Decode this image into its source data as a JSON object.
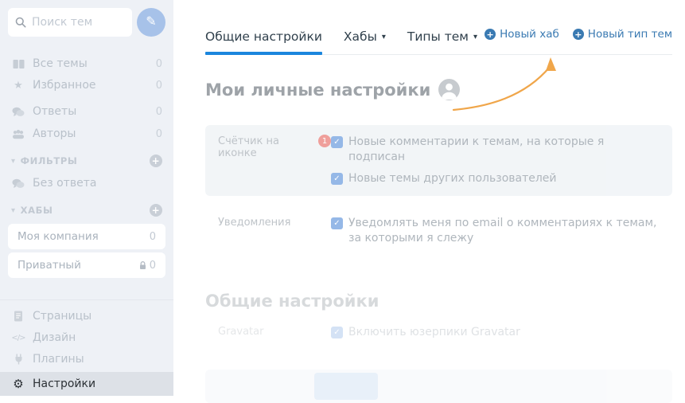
{
  "colors": {
    "accent_blue": "#1b86dd",
    "link_blue": "#3a7ab2",
    "arrow_orange": "#f0a64a",
    "badge_red": "#e2514a",
    "checkbox_blue": "#3f7fd4",
    "sidebar_bg": "#eef1f6",
    "active_item_bg": "#dde1e7"
  },
  "icons": {
    "plus": "+",
    "caret_down": "▾",
    "check": "✓",
    "star": "★",
    "gear": "⚙",
    "pencil": "✎",
    "code": "</>"
  },
  "sidebar": {
    "search": {
      "placeholder": "Поиск тем",
      "icon": "search-icon"
    },
    "compose": {
      "icon": "pencil-icon"
    },
    "nav": [
      {
        "label": "Все темы",
        "count": "0",
        "icon": "book-icon"
      },
      {
        "label": "Избранное",
        "count": "0",
        "icon": "star-icon"
      },
      {
        "label": "Ответы",
        "count": "0",
        "icon": "comments-icon"
      },
      {
        "label": "Авторы",
        "count": "0",
        "icon": "users-icon"
      }
    ],
    "sections": [
      {
        "title": "ФИЛЬТРЫ",
        "items": [
          {
            "label": "Без ответа",
            "icon": "comments-icon"
          }
        ]
      },
      {
        "title": "ХАБЫ",
        "hubs": [
          {
            "label": "Моя компания",
            "count": "0",
            "locked": false
          },
          {
            "label": "Приватный",
            "count": "0",
            "locked": true,
            "icon": "lock-icon"
          }
        ]
      }
    ],
    "footer": [
      {
        "label": "Страницы",
        "icon": "page-icon"
      },
      {
        "label": "Дизайн",
        "icon": "code-icon"
      },
      {
        "label": "Плагины",
        "icon": "plug-icon"
      },
      {
        "label": "Настройки",
        "icon": "gear-icon",
        "active": true
      }
    ]
  },
  "main": {
    "tabs": [
      {
        "label": "Общие настройки",
        "active": true,
        "dropdown": false
      },
      {
        "label": "Хабы",
        "active": false,
        "dropdown": true
      },
      {
        "label": "Типы тем",
        "active": false,
        "dropdown": true
      }
    ],
    "actions": [
      {
        "label": "Новый хаб",
        "icon": "plus-circle-icon"
      },
      {
        "label": "Новый тип тем",
        "icon": "plus-circle-icon"
      }
    ],
    "personal": {
      "title": "Мои личные настройки",
      "avatar_icon": "user-avatar-icon",
      "rows": [
        {
          "label": "Счётчик на иконке",
          "badge": "1",
          "options": [
            {
              "checked": true,
              "text": "Новые комментарии к темам, на которые я подписан"
            },
            {
              "checked": true,
              "text": "Новые темы других пользователей"
            }
          ]
        },
        {
          "label": "Уведомления",
          "options": [
            {
              "checked": true,
              "text": "Уведомлять меня по email о комментариях к темам, за которыми я слежу"
            }
          ]
        }
      ]
    },
    "general": {
      "title": "Общие настройки",
      "rows": [
        {
          "label": "Gravatar",
          "options": [
            {
              "checked": false,
              "text": "Включить юзерпики Gravatar"
            }
          ]
        }
      ]
    },
    "annotation": {
      "shape": "curved-arrow",
      "color": "#f0a64a",
      "points_to": "Новый хаб"
    }
  }
}
